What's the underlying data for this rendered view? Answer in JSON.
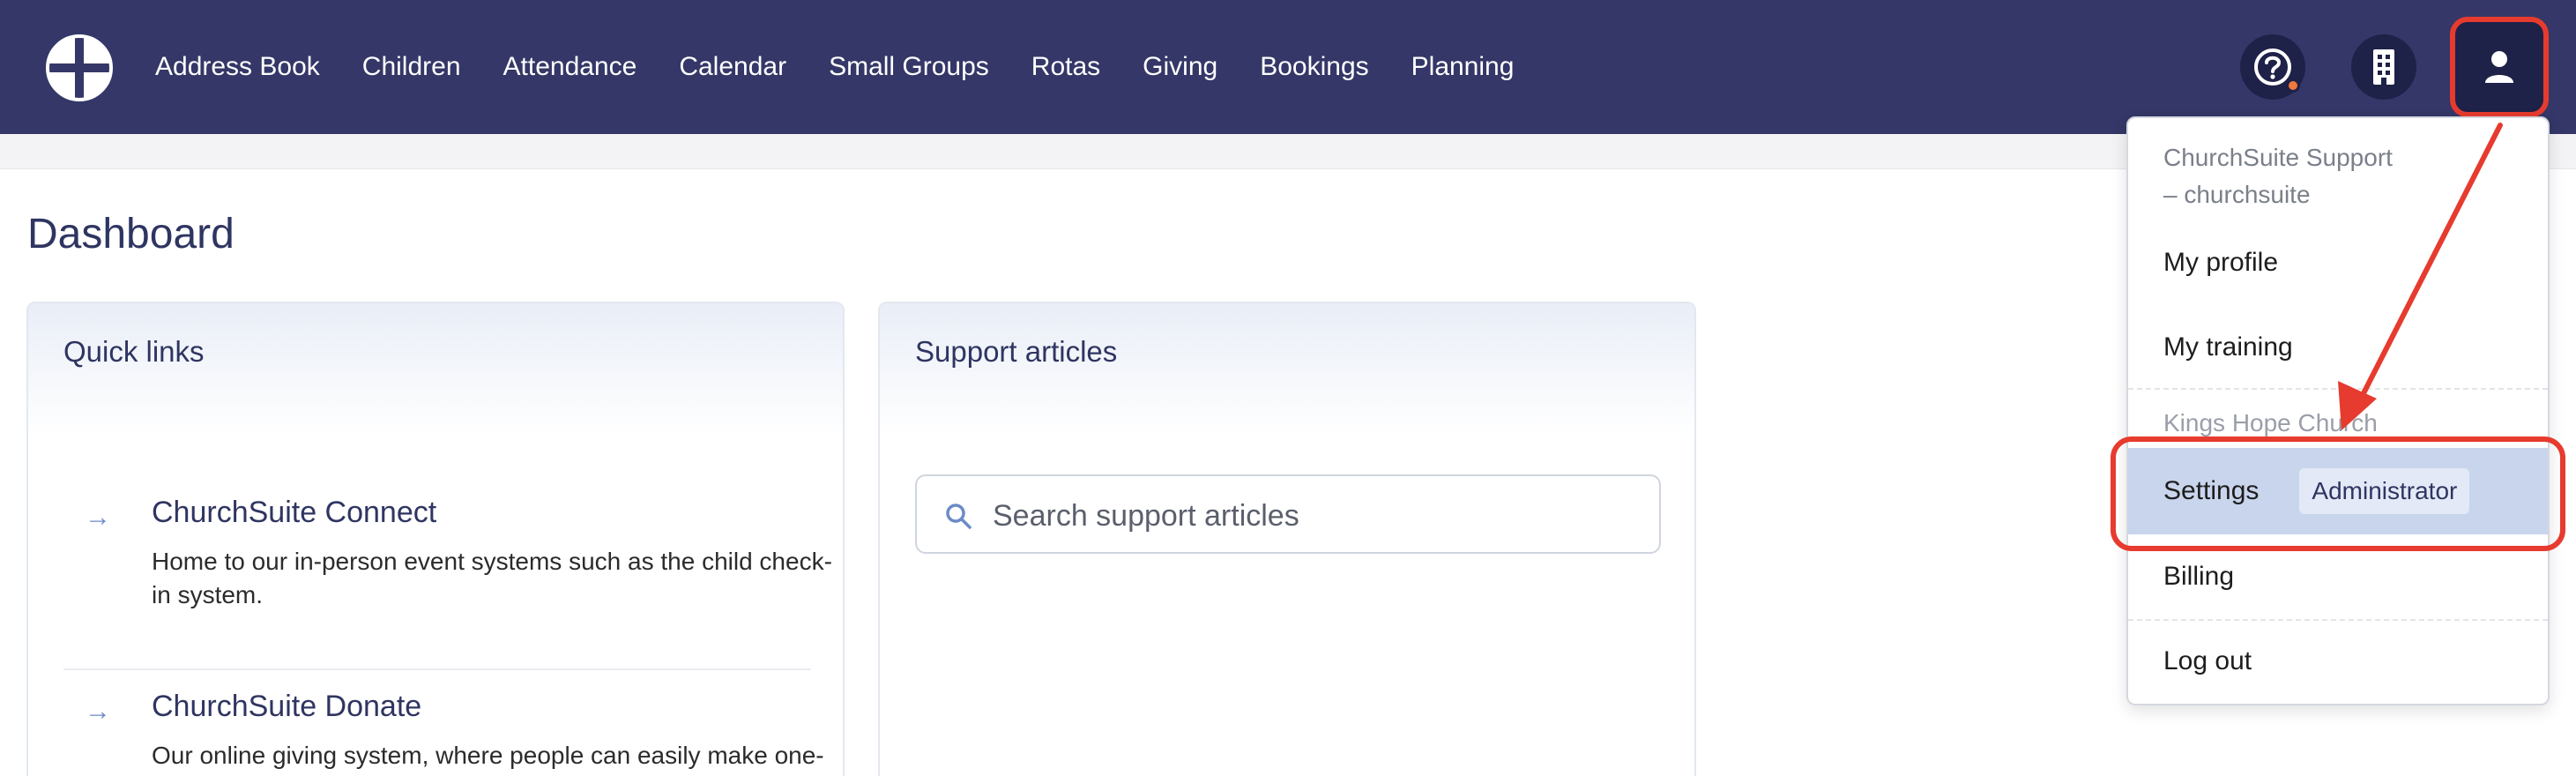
{
  "nav": {
    "items": [
      "Address Book",
      "Children",
      "Attendance",
      "Calendar",
      "Small Groups",
      "Rotas",
      "Giving",
      "Bookings",
      "Planning"
    ]
  },
  "icons": {
    "logo": "churchsuite-logo-icon",
    "help": "help-icon",
    "building": "building-icon",
    "user": "user-icon",
    "search": "search-icon",
    "arrow": "arrow-right-icon"
  },
  "colors": {
    "navbar": "#343767",
    "accent": "#2f3561",
    "annotation": "#e63b2e",
    "selected": "#c9d5ec"
  },
  "page": {
    "title": "Dashboard"
  },
  "quick_links": {
    "title": "Quick links",
    "items": [
      {
        "title": "ChurchSuite Connect",
        "desc": "Home to our in-person event systems such as the child check-in system."
      },
      {
        "title": "ChurchSuite Donate",
        "desc": "Our online giving system, where people can easily make one-off and recurring donations."
      }
    ]
  },
  "support": {
    "title": "Support articles",
    "search_placeholder": "Search support articles"
  },
  "menu": {
    "user_line1": "ChurchSuite Support",
    "user_line2": "– churchsuite",
    "my_profile": "My profile",
    "my_training": "My training",
    "church": "Kings Hope Church",
    "settings": "Settings",
    "settings_badge": "Administrator",
    "billing": "Billing",
    "logout": "Log out"
  }
}
